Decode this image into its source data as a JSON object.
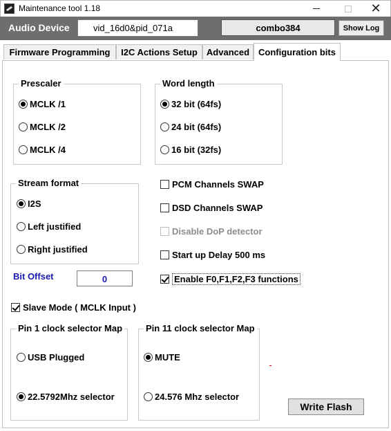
{
  "window": {
    "title": "Maintenance tool 1.18",
    "close_glyph": "✕"
  },
  "device": {
    "label": "Audio Device",
    "id_value": "vid_16d0&pid_071a",
    "status_value": "combo384",
    "show_log_label": "Show Log"
  },
  "tabs": [
    {
      "label": "Firmware Programming",
      "active": false
    },
    {
      "label": "I2C Actions Setup",
      "active": false
    },
    {
      "label": "Advanced",
      "active": false
    },
    {
      "label": "Configuration bits",
      "active": true
    }
  ],
  "prescaler": {
    "title": "Prescaler",
    "options": [
      {
        "label": "MCLK /1",
        "selected": true
      },
      {
        "label": "MCLK /2",
        "selected": false
      },
      {
        "label": "MCLK /4",
        "selected": false
      }
    ]
  },
  "word_length": {
    "title": "Word length",
    "options": [
      {
        "label": "32 bit (64fs)",
        "selected": true
      },
      {
        "label": "24 bit (64fs)",
        "selected": false
      },
      {
        "label": "16 bit (32fs)",
        "selected": false
      }
    ]
  },
  "stream_format": {
    "title": "Stream format",
    "options": [
      {
        "label": "I2S",
        "selected": true
      },
      {
        "label": "Left justified",
        "selected": false
      },
      {
        "label": "Right justified",
        "selected": false
      }
    ]
  },
  "checkboxes": [
    {
      "label": "PCM Channels SWAP",
      "checked": false,
      "enabled": true
    },
    {
      "label": "DSD Channels SWAP",
      "checked": false,
      "enabled": true
    },
    {
      "label": "Disable DoP detector",
      "checked": false,
      "enabled": false
    },
    {
      "label": "Start up Delay 500 ms",
      "checked": false,
      "enabled": true
    },
    {
      "label": "Enable F0,F1,F2,F3 functions",
      "checked": true,
      "enabled": true
    }
  ],
  "bit_offset": {
    "label": "Bit Offset",
    "value": "0"
  },
  "slave_mode": {
    "label": "Slave Mode ( MCLK Input )",
    "checked": true
  },
  "pin1_map": {
    "title": "Pin 1 clock selector Map",
    "options": [
      {
        "label": "USB Plugged",
        "selected": false
      },
      {
        "label": "22.5792Mhz selector",
        "selected": true
      }
    ]
  },
  "pin11_map": {
    "title": "Pin 11 clock selector Map",
    "options": [
      {
        "label": "MUTE",
        "selected": true
      },
      {
        "label": "24.576 Mhz selector",
        "selected": false
      }
    ]
  },
  "write_flash_label": "Write Flash",
  "colors": {
    "device_bar": "#6e6e6e",
    "bit_offset_text": "#1a1ab0",
    "red_mark": "#d00000"
  }
}
